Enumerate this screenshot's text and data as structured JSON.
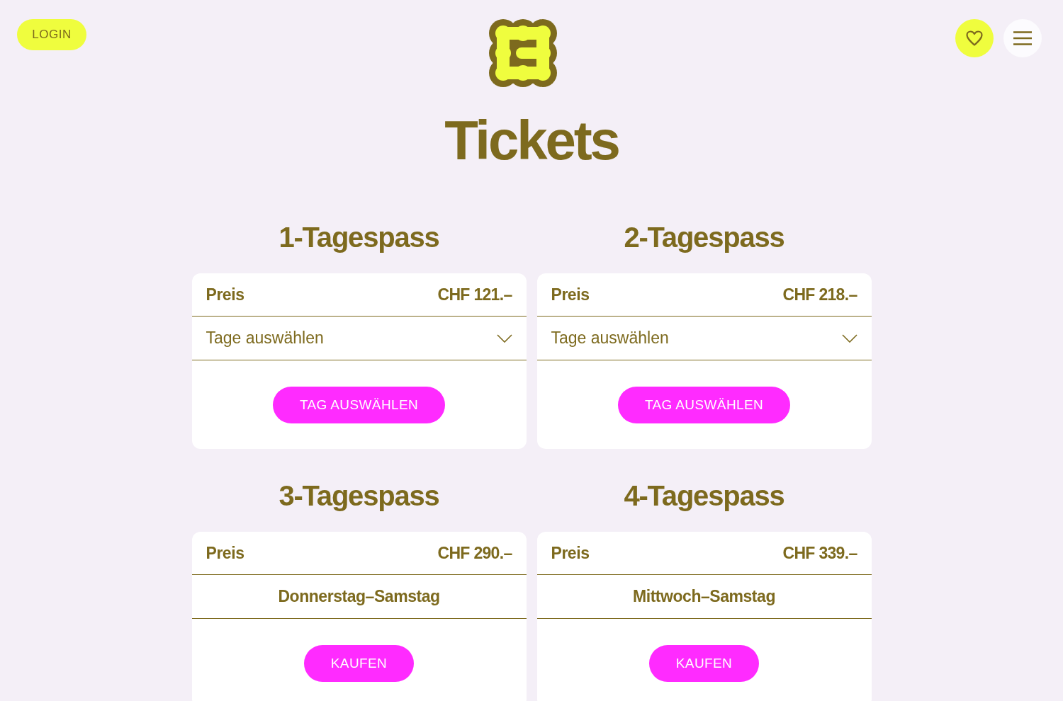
{
  "header": {
    "login_button": "LOGIN"
  },
  "page_title": "Tickets",
  "passes": [
    {
      "title": "1-Tagespass",
      "price_label": "Preis",
      "price": "CHF 121.–",
      "kind": "select",
      "placeholder": "Tage auswählen",
      "button": "TAG AUSWÄHLEN"
    },
    {
      "title": "2-Tagespass",
      "price_label": "Preis",
      "price": "CHF 218.–",
      "kind": "select",
      "placeholder": "Tage auswählen",
      "button": "TAG AUSWÄHLEN"
    },
    {
      "title": "3-Tagespass",
      "price_label": "Preis",
      "price": "CHF 290.–",
      "kind": "fixed",
      "days": "Donnerstag–Samstag",
      "button": "KAUFEN"
    },
    {
      "title": "4-Tagespass",
      "price_label": "Preis",
      "price": "CHF 339.–",
      "kind": "fixed",
      "days": "Mittwoch–Samstag",
      "button": "KAUFEN"
    }
  ]
}
